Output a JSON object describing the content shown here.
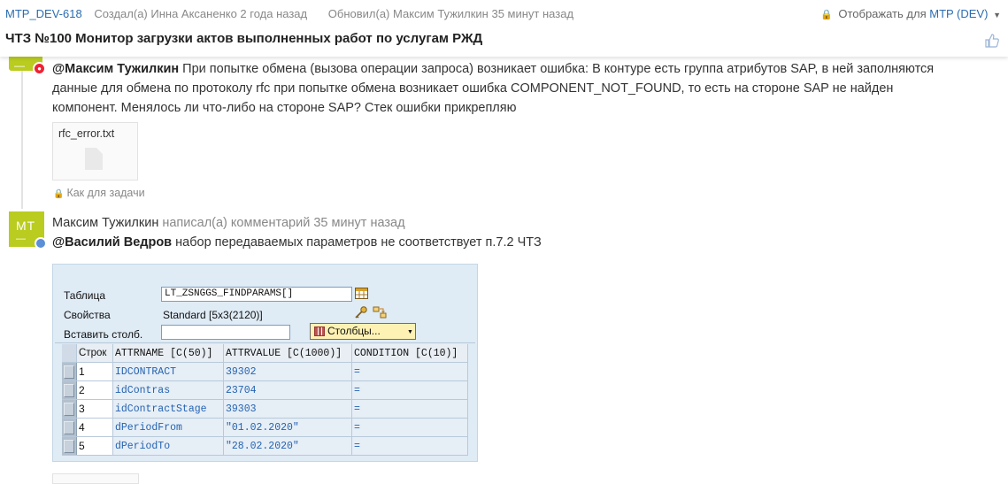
{
  "header": {
    "issue_key": "MTP_DEV-618",
    "created": "Создал(а) Инна Аксаненко 2 года назад",
    "updated": "Обновил(а) Максим Тужилкин 35 минут назад",
    "visibility_prefix": "Отображать для",
    "visibility_scope": "MTP (DEV)",
    "title": "ЧТЗ №100 Монитор загрузки актов выполненных работ по услугам РЖД"
  },
  "comment1": {
    "mention": "@Максим Тужилкин",
    "text": " При попытке обмена (вызова операции запроса) возникает ошибка: В контуре есть группа атрибутов SAP, в ней заполняются данные для обмена по протоколу rfc при попытке обмена возникает ошибка COMPONENT_NOT_FOUND, то есть на стороне SAP не найден компонент. Менялось ли что-либо на стороне SAP? Стек ошибки прикрепляю",
    "attachment": "rfc_error.txt",
    "visibility": "Как для задачи"
  },
  "comment2": {
    "avatar_initials": "MT",
    "author": "Максим Тужилкин",
    "action": " написал(а) комментарий 35 минут назад",
    "mention": "@Василий Ведров",
    "text": " набор передаваемых параметров не соответствует п.7.2 ЧТЗ"
  },
  "sap": {
    "table_label": "Таблица",
    "table_value": "LT_ZSNGGS_FINDPARAMS[]",
    "props_label": "Свойства",
    "props_value": "Standard [5x3(2120)]",
    "insert_label": "Вставить столб.",
    "insert_value": "",
    "columns_button": "Столбцы...",
    "grid_headers": [
      "Строк",
      "ATTRNAME [C(50)]",
      "ATTRVALUE [C(1000)]",
      "CONDITION [C(10)]"
    ],
    "rows": [
      {
        "n": "1",
        "name": "IDCONTRACT",
        "value": "39302",
        "cond": "="
      },
      {
        "n": "2",
        "name": "idContras",
        "value": "23704",
        "cond": "="
      },
      {
        "n": "3",
        "name": "idContractStage",
        "value": "39303",
        "cond": "="
      },
      {
        "n": "4",
        "name": "dPeriodFrom",
        "value": "\"01.02.2020\"",
        "cond": "="
      },
      {
        "n": "5",
        "name": "dPeriodTo",
        "value": "\"28.02.2020\"",
        "cond": "="
      }
    ]
  },
  "icons": {
    "lock": "lock-icon",
    "like": "thumbs-up-icon",
    "file": "file-icon",
    "table_view": "table-view-icon",
    "key": "key-icon",
    "transfer": "transfer-icon",
    "columns": "columns-icon"
  },
  "colors": {
    "link": "#2b6cb0",
    "avatar": "#b9cc1f",
    "sap_bg": "#dfebf5",
    "sap_cell_text": "#2463b0",
    "button_yellow": "#fdf2b3"
  }
}
